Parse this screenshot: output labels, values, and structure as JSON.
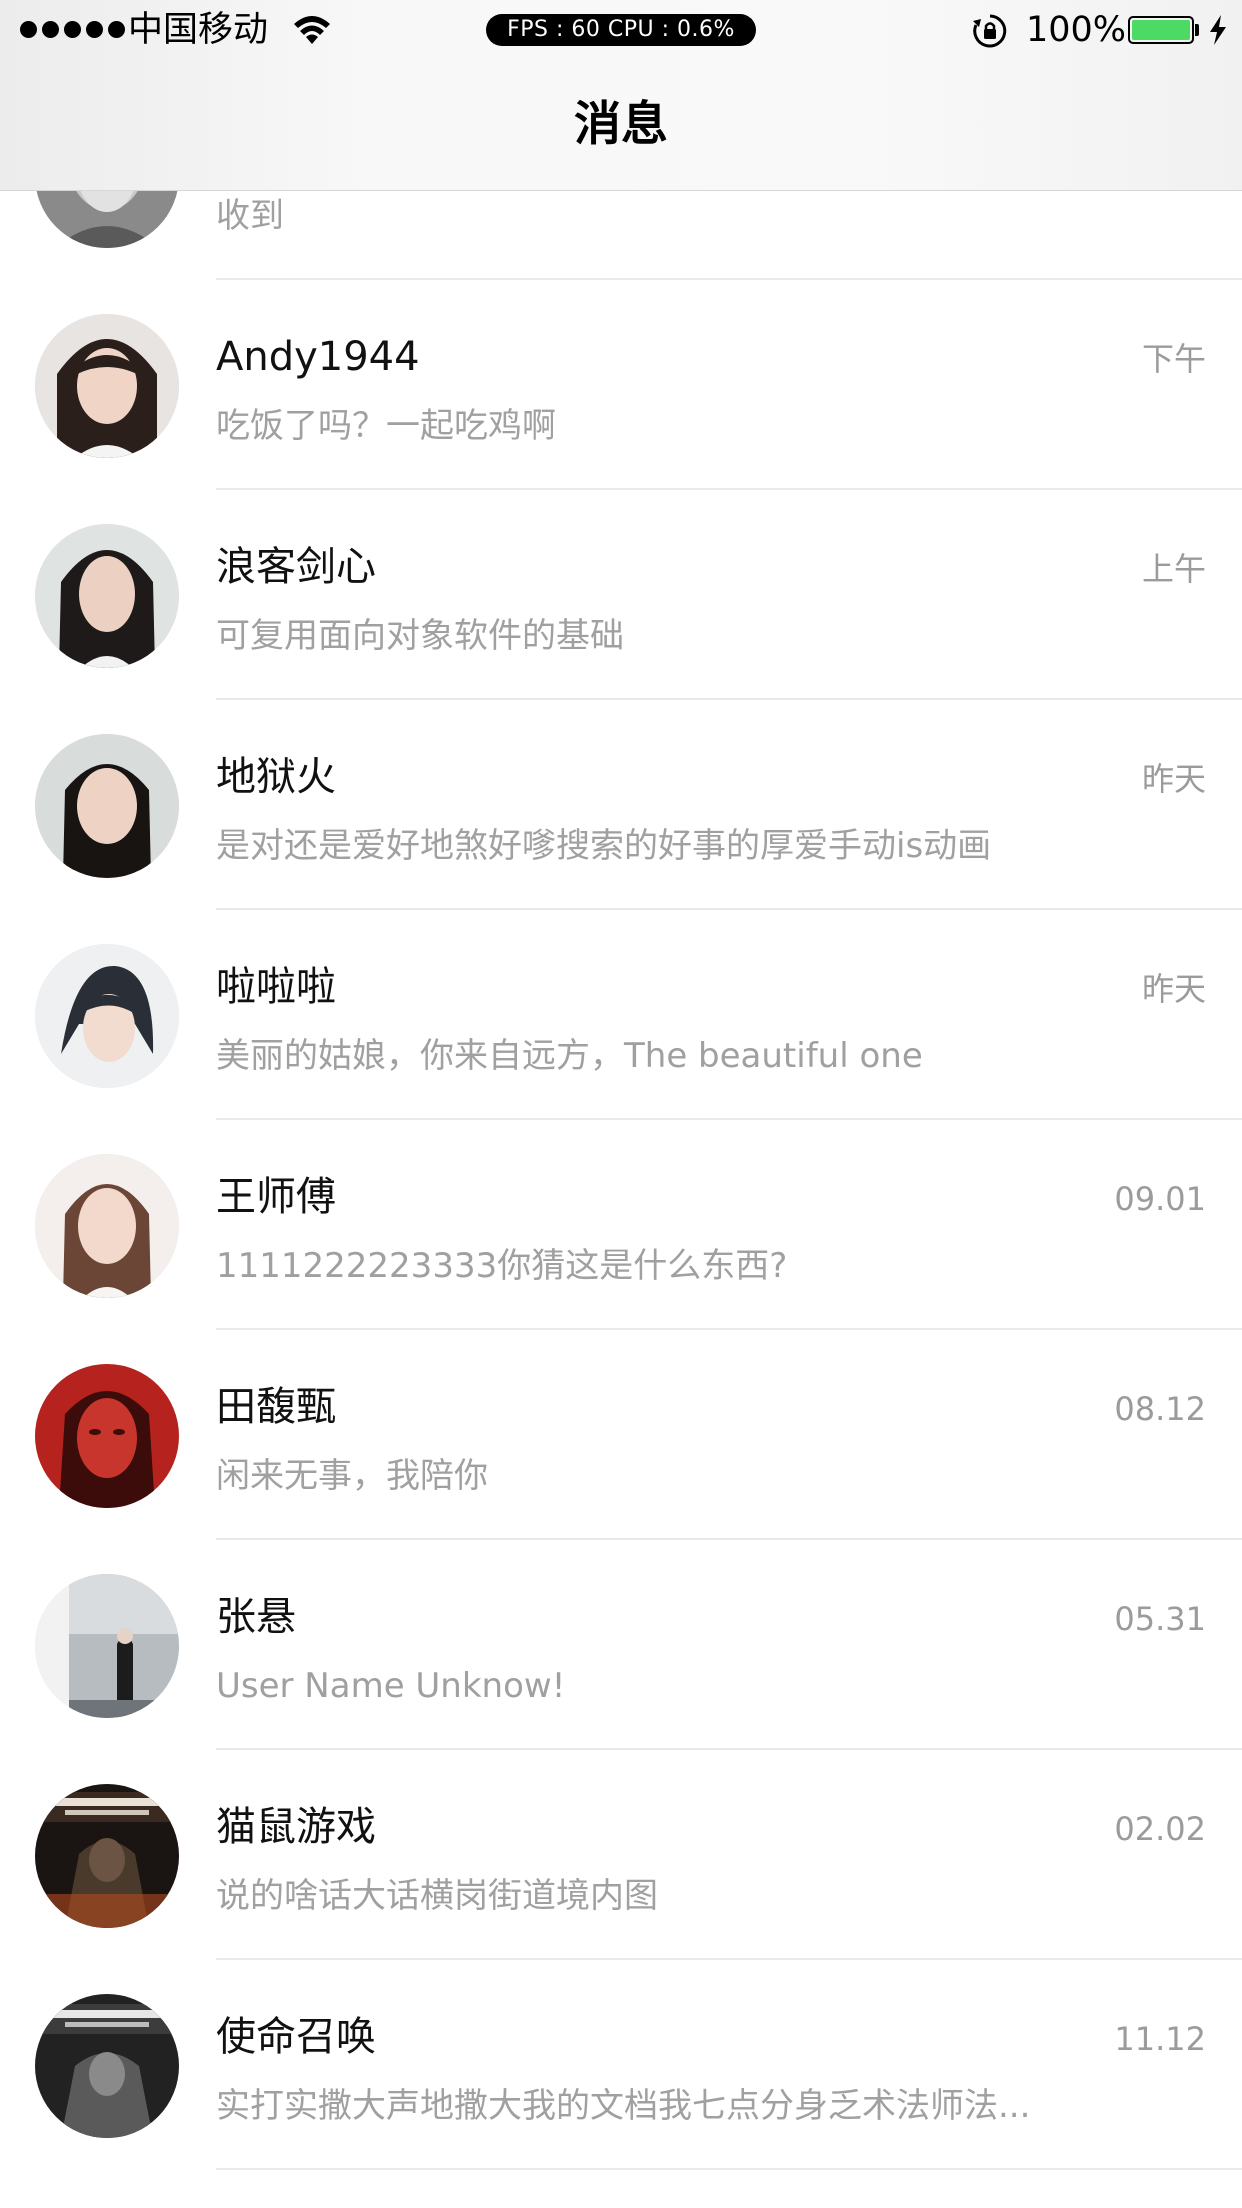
{
  "status_bar": {
    "carrier": "中国移动",
    "fps": "FPS : 60 CPU : 0.6%",
    "battery_percent": "100%",
    "battery_level": 1.0,
    "battery_color": "#4cd964"
  },
  "nav": {
    "title": "消息"
  },
  "messages": [
    {
      "name": "",
      "time": "",
      "preview": "收到",
      "avatar": "avatar-grey"
    },
    {
      "name": "Andy1944",
      "time": "下午",
      "preview": "吃饭了吗？一起吃鸡啊",
      "avatar": "avatar-girl-1"
    },
    {
      "name": "浪客剑心",
      "time": "上午",
      "preview": "可复用面向对象软件的基础",
      "avatar": "avatar-girl-2"
    },
    {
      "name": "地狱火",
      "time": "昨天",
      "preview": "是对还是爱好地煞好嗲搜索的好事的厚爱手动is动画",
      "avatar": "avatar-girl-3"
    },
    {
      "name": "啦啦啦",
      "time": "昨天",
      "preview": "美丽的姑娘，你来自远方，The beautiful one",
      "avatar": "avatar-girl-4"
    },
    {
      "name": "王师傅",
      "time": "09.01",
      "preview": "1111222223333你猜这是什么东西?",
      "avatar": "avatar-girl-5"
    },
    {
      "name": "田馥甄",
      "time": "08.12",
      "preview": "闲来无事，我陪你",
      "avatar": "avatar-red"
    },
    {
      "name": "张悬",
      "time": "05.31",
      "preview": "User Name Unknow!",
      "avatar": "avatar-poster"
    },
    {
      "name": "猫鼠游戏",
      "time": "02.02",
      "preview": "说的啥话大话横岗街道境内图",
      "avatar": "avatar-game-1"
    },
    {
      "name": "使命召唤",
      "time": "11.12",
      "preview": "实打实撒大声地撒大我的文档我七点分身乏术法师法...",
      "avatar": "avatar-game-2"
    }
  ],
  "colors": {
    "name_text": "#111111",
    "secondary_text": "#a0a0a0",
    "divider": "#e9e9e9"
  }
}
